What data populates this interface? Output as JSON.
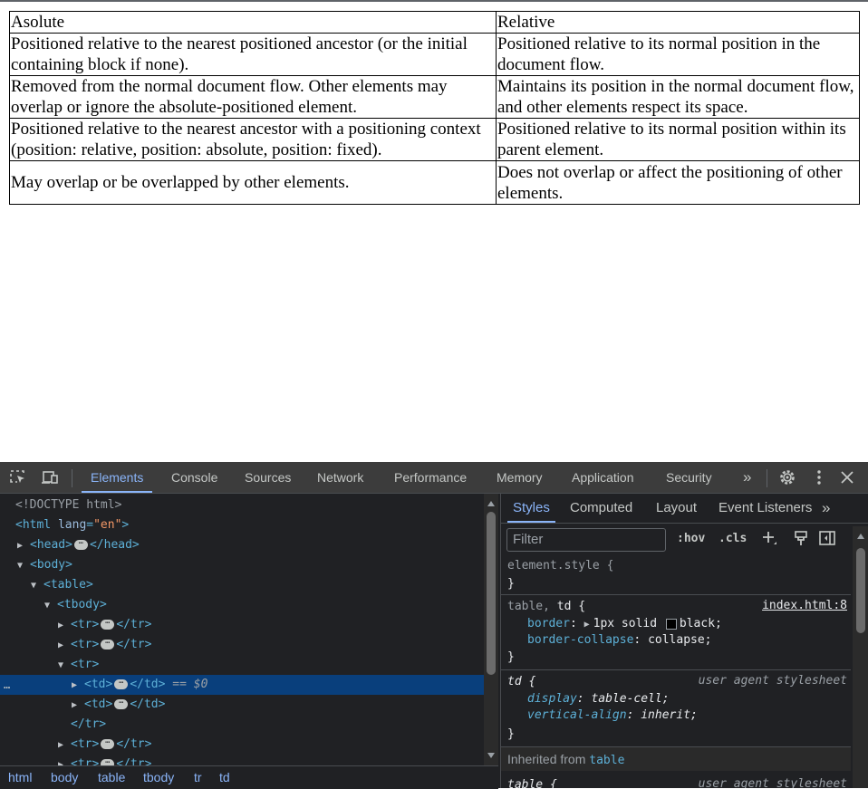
{
  "table": {
    "header": [
      "Asolute",
      "Relative"
    ],
    "rows": [
      [
        "Positioned relative to the nearest positioned ancestor (or the initial containing block if none).",
        "Positioned relative to its normal position in the document flow."
      ],
      [
        "Removed from the normal document flow. Other elements may overlap or ignore the absolute-positioned element.",
        "Maintains its position in the normal document flow, and other elements respect its space."
      ],
      [
        "Positioned relative to the nearest ancestor with a positioning context (position: relative, position: absolute, position: fixed).",
        "Positioned relative to its normal position within its parent element."
      ],
      [
        "May overlap or be overlapped by other elements.",
        "Does not overlap or affect the positioning of other elements."
      ]
    ]
  },
  "devtools": {
    "tabs": [
      "Elements",
      "Console",
      "Sources",
      "Network",
      "Performance",
      "Memory",
      "Application",
      "Security"
    ],
    "active_tab": "Elements",
    "more": "»",
    "dom": {
      "doctype": "<!DOCTYPE html>",
      "html_open": "<html",
      "lang_attr": "lang",
      "lang_val": "\"en\"",
      "gt": ">",
      "head_open": "<head>",
      "head_close": "</head>",
      "body": "<body>",
      "table": "<table>",
      "tbody": "<tbody>",
      "tr_open": "<tr>",
      "tr_close": "</tr>",
      "td_open": "<td>",
      "td_close": "</td>",
      "selected_marker": "== $0",
      "ellipsis": "…",
      "dots": "⋯"
    },
    "breadcrumbs": [
      "html",
      "body",
      "table",
      "tbody",
      "tr",
      "td"
    ],
    "styles": {
      "tabs": [
        "Styles",
        "Computed",
        "Layout",
        "Event Listeners"
      ],
      "active_tab": "Styles",
      "filter_placeholder": "Filter",
      "hov": ":hov",
      "cls": ".cls",
      "element_style": "element.style {",
      "close_brace": "}",
      "rule1_selector_a": "table,",
      "rule1_selector_b": "td {",
      "rule1_source": "index.html:8",
      "rule1_prop1": "border",
      "rule1_val1a": "1px solid",
      "rule1_val1b": "black;",
      "rule1_prop2": "border-collapse",
      "rule1_val2": "collapse;",
      "rule2_selector": "td {",
      "rule2_source": "user agent stylesheet",
      "rule2_prop1": "display",
      "rule2_val1": "table-cell;",
      "rule2_prop2": "vertical-align",
      "rule2_val2": "inherit;",
      "inherited_label": "Inherited from",
      "inherited_tag": "table",
      "rule3_selector": "table {",
      "rule3_source": "user agent stylesheet",
      "colon": ":"
    }
  }
}
